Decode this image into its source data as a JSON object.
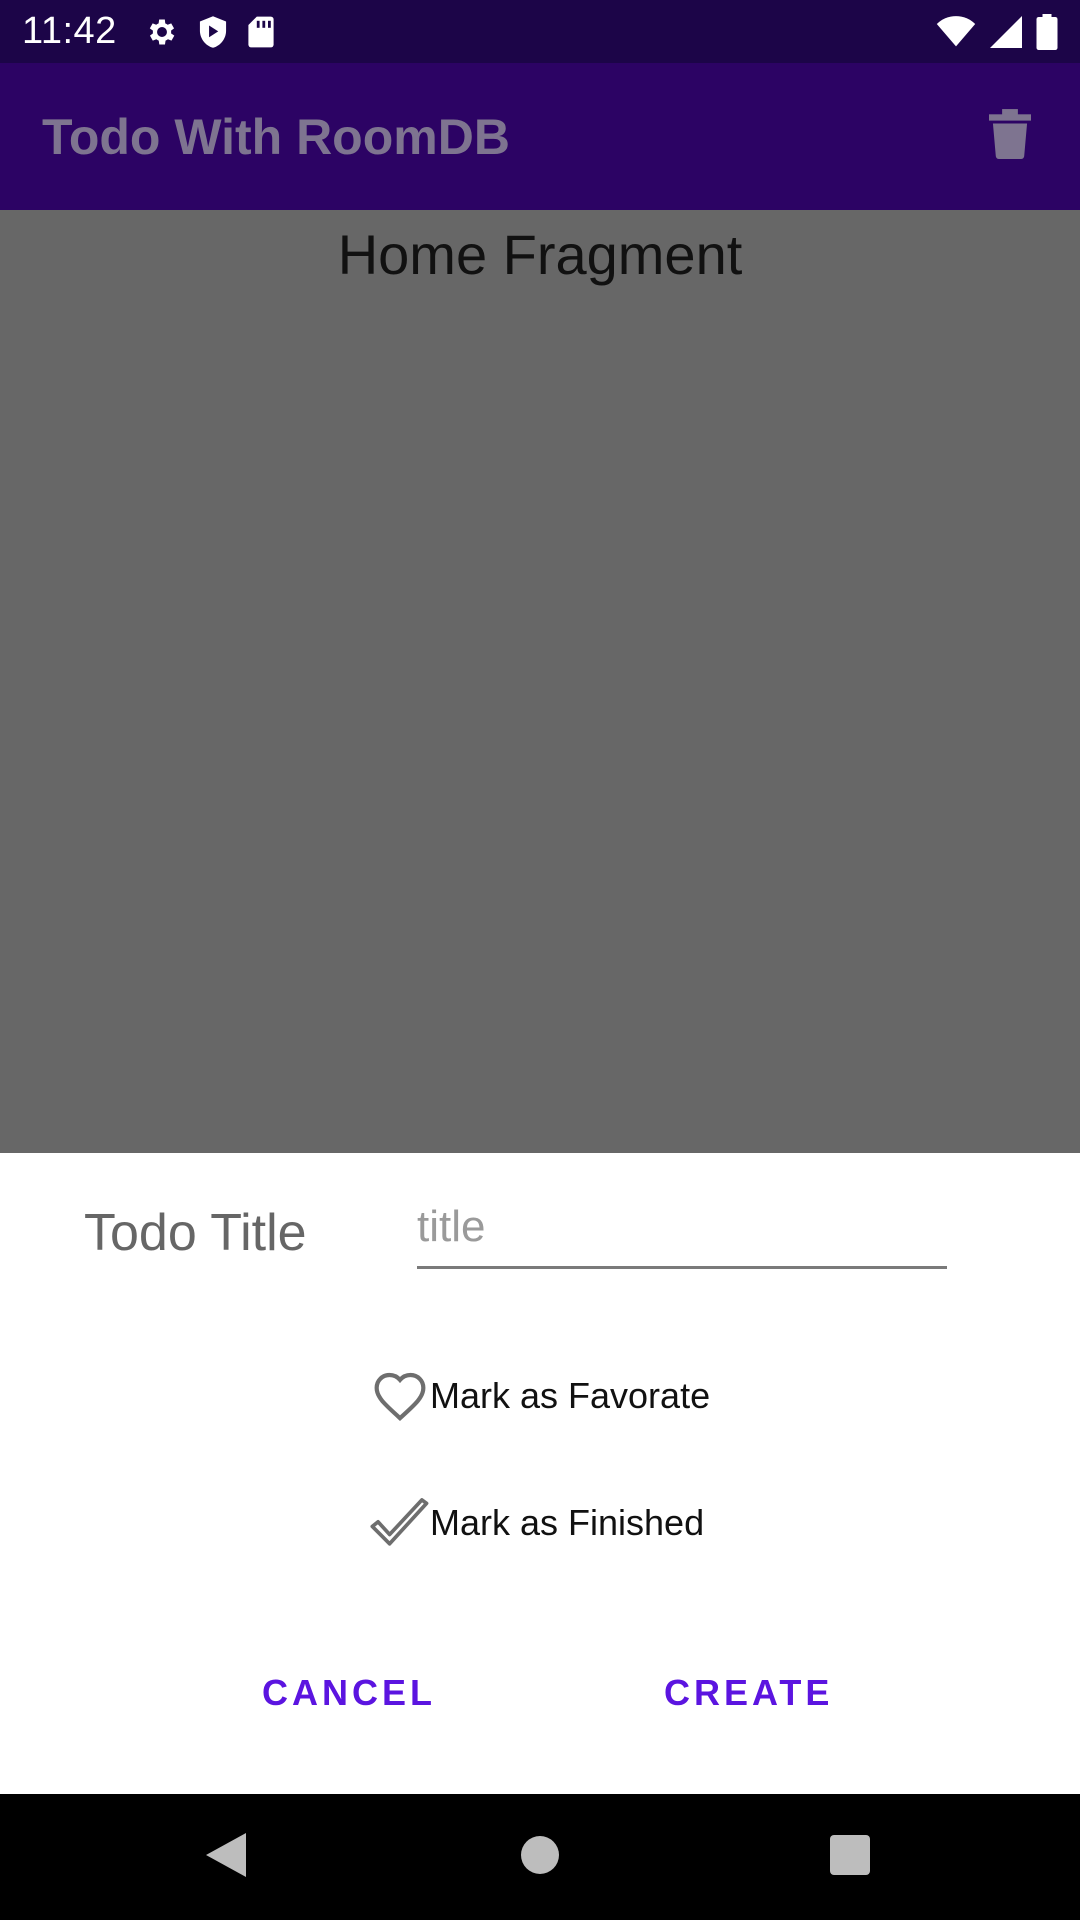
{
  "status_bar": {
    "time": "11:42",
    "left_icons": [
      "gear-icon",
      "shield-icon",
      "sd-card-icon"
    ],
    "right_icons": [
      "wifi-icon",
      "signal-icon",
      "battery-icon"
    ]
  },
  "app_bar": {
    "title": "Todo With RoomDB",
    "action_icon": "trash-icon"
  },
  "content": {
    "fragment_label": "Home Fragment"
  },
  "dialog": {
    "title_label": "Todo Title",
    "title_input": {
      "value": "",
      "placeholder": "title"
    },
    "favorite_label": "Mark as Favorate",
    "finished_label": "Mark as Finished",
    "cancel_label": "CANCEL",
    "create_label": "CREATE",
    "accent_color": "#5b14e0"
  },
  "nav_bar": {
    "buttons": [
      "back-icon",
      "home-icon",
      "recents-icon"
    ]
  }
}
